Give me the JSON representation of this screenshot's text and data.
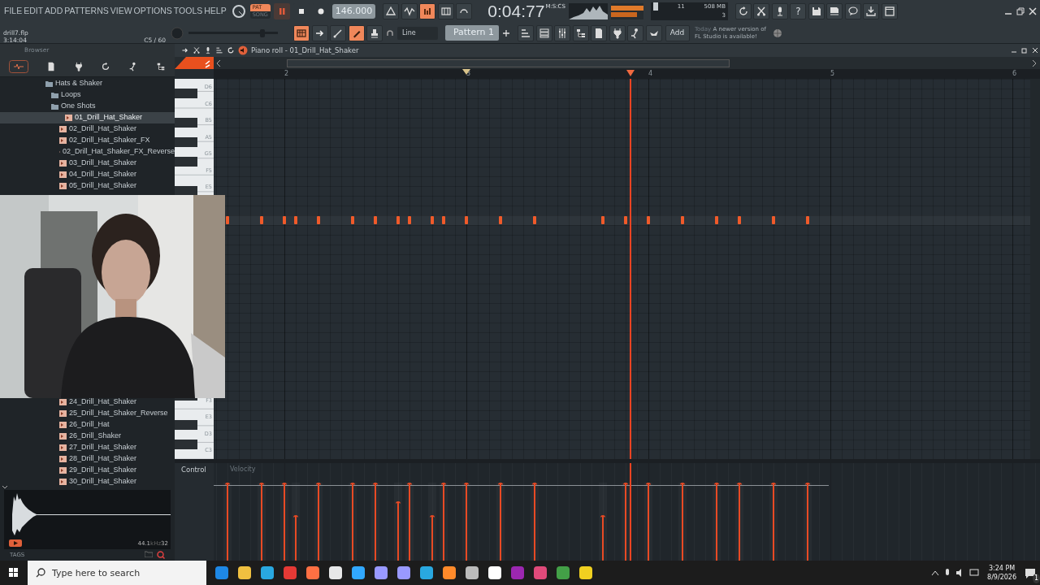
{
  "menu": [
    "FILE",
    "EDIT",
    "ADD",
    "PATTERNS",
    "VIEW",
    "OPTIONS",
    "TOOLS",
    "HELP"
  ],
  "project": {
    "file": "drill7.flp",
    "time": "3:14:04",
    "note": "C5 / 60"
  },
  "mode": [
    {
      "label": "PAT",
      "selected": true
    },
    {
      "label": "SONG",
      "selected": false
    }
  ],
  "transport": [
    {
      "kind": "pause",
      "on": true
    },
    {
      "kind": "stop",
      "on": false
    },
    {
      "kind": "record",
      "on": false
    }
  ],
  "tempo": "146.000",
  "tools_top": [
    {
      "kind": "metronome",
      "on": false
    },
    {
      "kind": "wave",
      "on": false
    },
    {
      "kind": "count",
      "on": true
    },
    {
      "kind": "step",
      "on": false
    },
    {
      "kind": "loop",
      "on": false
    }
  ],
  "clock": {
    "unit": "M:S:CS",
    "time": "0:04:77"
  },
  "monitor": {
    "cpu": "11",
    "memory": "508 MB",
    "polyphony": "3"
  },
  "tools_right": [
    {
      "kind": "refresh"
    },
    {
      "kind": "scissors"
    },
    {
      "kind": "mic"
    },
    {
      "kind": "text",
      "label": "?"
    },
    {
      "kind": "save"
    },
    {
      "kind": "disk"
    },
    {
      "kind": "chat"
    },
    {
      "kind": "download"
    },
    {
      "kind": "window"
    }
  ],
  "master_pitch": {
    "level": 0.85
  },
  "tools_row2": [
    {
      "kind": "grid",
      "on": true
    },
    {
      "kind": "arrow",
      "on": false
    },
    {
      "kind": "slide",
      "on": false
    },
    {
      "kind": "pencil",
      "on": true
    },
    {
      "kind": "stamp",
      "on": false
    }
  ],
  "pattern": {
    "snap": "Line",
    "name": "Pattern 1",
    "add": "Add"
  },
  "tools_windows": [
    {
      "kind": "lines"
    },
    {
      "kind": "list"
    },
    {
      "kind": "mixer"
    },
    {
      "kind": "tree"
    },
    {
      "kind": "page"
    },
    {
      "kind": "plug"
    },
    {
      "kind": "person"
    },
    {
      "kind": "bird"
    }
  ],
  "news": {
    "date": "Today",
    "message": "A newer version of FL Studio is available!"
  },
  "browser": {
    "title": "Browser",
    "tree": [
      {
        "label": "Hats & Shaker",
        "kind": "folder",
        "selected": false,
        "children": [
          {
            "label": "Loops",
            "kind": "folder",
            "selected": false
          },
          {
            "label": "One Shots",
            "kind": "folder",
            "selected": false,
            "children": [
              {
                "label": "01_Drill_Hat_Shaker",
                "kind": "file",
                "selected": true,
                "gap_before": false
              },
              {
                "label": "02_Drill_Hat_Shaker",
                "kind": "file",
                "selected": false,
                "gap_before": false
              },
              {
                "label": "02_Drill_Hat_Shaker_FX",
                "kind": "file",
                "selected": false,
                "gap_before": false
              },
              {
                "label": "02_Drill_Hat_Shaker_FX_Reverse",
                "kind": "file",
                "selected": false,
                "gap_before": false
              },
              {
                "label": "03_Drill_Hat_Shaker",
                "kind": "file",
                "selected": false,
                "gap_before": false
              },
              {
                "label": "04_Drill_Hat_Shaker",
                "kind": "file",
                "selected": false,
                "gap_before": false
              },
              {
                "label": "05_Drill_Hat_Shaker",
                "kind": "file",
                "selected": false,
                "gap_before": false
              },
              {
                "label": "24_Drill_Hat_Shaker",
                "kind": "file",
                "selected": false,
                "gap_before": true
              },
              {
                "label": "25_Drill_Hat_Shaker_Reverse",
                "kind": "file",
                "selected": false,
                "gap_before": false
              },
              {
                "label": "26_Drill_Hat",
                "kind": "file",
                "selected": false,
                "gap_before": false
              },
              {
                "label": "26_Drill_Shaker",
                "kind": "file",
                "selected": false,
                "gap_before": false
              },
              {
                "label": "27_Drill_Hat_Shaker",
                "kind": "file",
                "selected": false,
                "gap_before": false
              },
              {
                "label": "28_Drill_Hat_Shaker",
                "kind": "file",
                "selected": false,
                "gap_before": false
              },
              {
                "label": "29_Drill_Hat_Shaker",
                "kind": "file",
                "selected": false,
                "gap_before": false
              },
              {
                "label": "30_Drill_Hat_Shaker",
                "kind": "file",
                "selected": false,
                "gap_before": false
              }
            ]
          }
        ]
      }
    ],
    "preview": {
      "rate": "44.1",
      "unit": "kHz",
      "bits": "32"
    },
    "tags": "TAGS"
  },
  "webcam": {
    "kind": "picture"
  },
  "piano_roll": {
    "title": "Piano roll - 01_Drill_Hat_Shaker",
    "keys_top": [
      "D6",
      "C6",
      "B5",
      "A5",
      "G5",
      "F5",
      "E5"
    ],
    "keys_bottom": [
      "F3",
      "E3",
      "D3",
      "C3"
    ],
    "bars": [
      "2",
      "3",
      "4",
      "5",
      "6"
    ],
    "notes": [
      {
        "level": 1
      },
      {
        "level": 1
      },
      {
        "level": 1
      },
      {
        "level": 0.58
      },
      {
        "level": 1
      },
      {
        "level": 1
      },
      {
        "level": 1
      },
      {
        "level": 0.76
      },
      {
        "level": 1
      },
      {
        "level": 0.58
      },
      {
        "level": 1
      },
      {
        "level": 1
      },
      {
        "level": 1
      },
      {
        "level": 1
      },
      {
        "level": 0.58
      },
      {
        "level": 1
      },
      {
        "level": 1
      },
      {
        "level": 1
      },
      {
        "level": 1
      },
      {
        "level": 1
      },
      {
        "level": 1
      },
      {
        "level": 1
      }
    ],
    "control": {
      "label": "Control",
      "parameter": "Velocity"
    }
  },
  "taskbar": {
    "search_placeholder": "Type here to search",
    "time": "3:24 PM",
    "date": "8/9/2026",
    "notifications": "1"
  }
}
